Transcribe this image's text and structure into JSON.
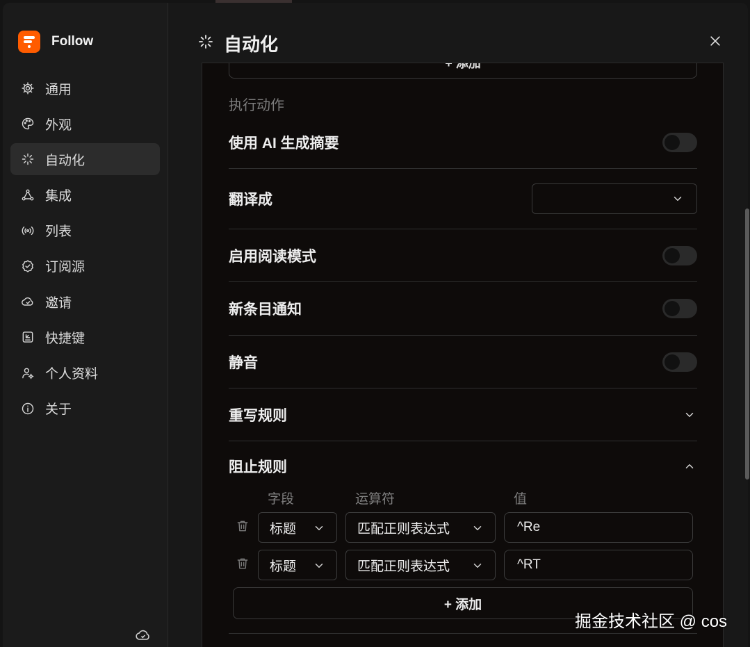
{
  "app": {
    "name": "Follow",
    "accent": "#ff5c00"
  },
  "sidebar": {
    "items": [
      {
        "label": "通用",
        "icon": "gear-icon"
      },
      {
        "label": "外观",
        "icon": "palette-icon"
      },
      {
        "label": "自动化",
        "icon": "magic-wand-icon",
        "active": true
      },
      {
        "label": "集成",
        "icon": "integration-icon"
      },
      {
        "label": "列表",
        "icon": "broadcast-icon"
      },
      {
        "label": "订阅源",
        "icon": "verified-badge-icon"
      },
      {
        "label": "邀请",
        "icon": "invite-cloud-icon"
      },
      {
        "label": "快捷键",
        "icon": "keyboard-icon"
      },
      {
        "label": "个人资料",
        "icon": "user-settings-icon"
      },
      {
        "label": "关于",
        "icon": "info-icon"
      }
    ]
  },
  "header": {
    "title": "自动化"
  },
  "actions": {
    "top_add_label": "+ 添加",
    "section_title": "执行动作",
    "rows": {
      "ai_summary": {
        "label": "使用 AI 生成摘要",
        "enabled": false
      },
      "translate": {
        "label": "翻译成",
        "value": ""
      },
      "readability": {
        "label": "启用阅读模式",
        "enabled": false
      },
      "notify": {
        "label": "新条目通知",
        "enabled": false
      },
      "mute": {
        "label": "静音",
        "enabled": false
      },
      "rewrite": {
        "label": "重写规则",
        "expanded": false
      },
      "block": {
        "label": "阻止规则",
        "expanded": true
      }
    }
  },
  "block_rules": {
    "columns": {
      "field": "字段",
      "operator": "运算符",
      "value": "值"
    },
    "rules": [
      {
        "field": "标题",
        "operator": "匹配正则表达式",
        "value": "^Re"
      },
      {
        "field": "标题",
        "operator": "匹配正则表达式",
        "value": "^RT"
      }
    ],
    "add_label": "+ 添加"
  },
  "watermark": "掘金技术社区 @ cos"
}
